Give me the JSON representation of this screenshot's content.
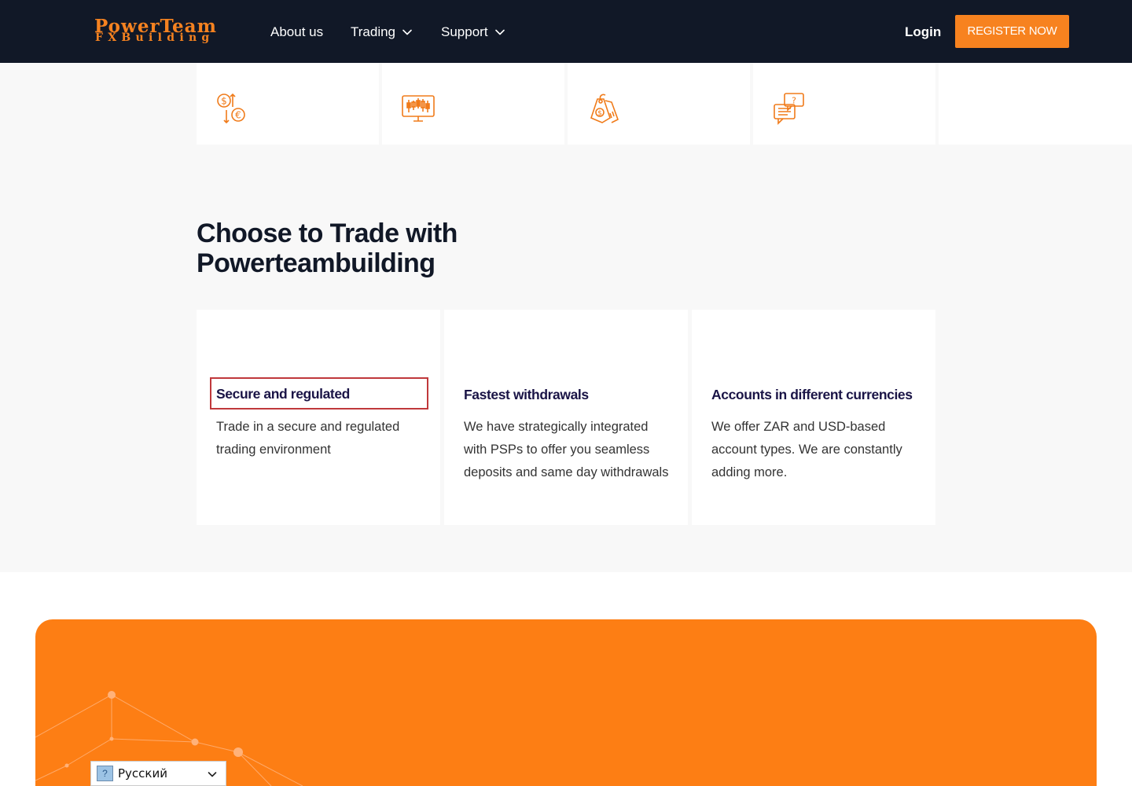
{
  "header": {
    "logo_top": "PowerTeam",
    "logo_bottom": "FXBuilding",
    "nav": [
      {
        "label": "About us"
      },
      {
        "label": "Trading"
      },
      {
        "label": "Support"
      }
    ],
    "login_label": "Login",
    "register_label": "REGISTER NOW"
  },
  "top_cards": [
    {
      "icon": "currency-exchange-icon"
    },
    {
      "icon": "trading-monitor-icon"
    },
    {
      "icon": "money-tags-icon"
    },
    {
      "icon": "chat-support-icon"
    }
  ],
  "choose": {
    "title": "Choose to Trade with Powerteambuilding",
    "cards": [
      {
        "title": "Secure and regulated",
        "text": "Trade in a secure and regulated trading environment"
      },
      {
        "title": "Fastest withdrawals",
        "text": "We have strategically integrated with PSPs to offer you seamless deposits and same day withdrawals"
      },
      {
        "title": "Accounts in different currencies",
        "text": "We offer ZAR and USD-based account types. We are constantly adding more."
      }
    ]
  },
  "language": {
    "selected": "Русский",
    "flag": "?"
  },
  "colors": {
    "header_bg": "#111827",
    "accent": "#f7821f",
    "banner": "#fd7e14",
    "heading": "#1a1446",
    "highlight_border": "#c0383b"
  }
}
